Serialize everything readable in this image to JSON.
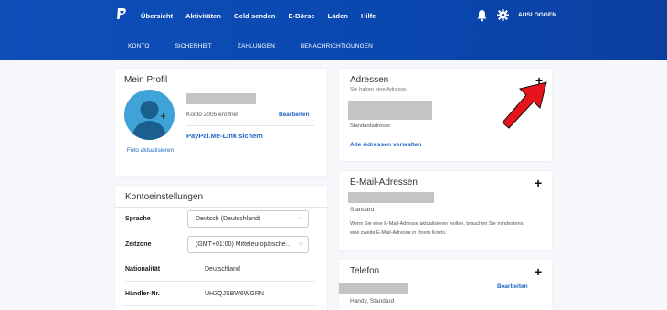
{
  "header": {
    "nav": [
      "Übersicht",
      "Aktivitäten",
      "Geld senden",
      "E-Börse",
      "Läden",
      "Hilfe"
    ],
    "logout": "AUSLOGGEN"
  },
  "subnav": [
    "KONTO",
    "SICHERHEIT",
    "ZAHLUNGEN",
    "BENACHRICHTIGUNGEN"
  ],
  "profile": {
    "title": "Mein Profil",
    "account_since": "Konto 2005 eröffnet",
    "edit": "Bearbeiten",
    "photo_update": "Foto aktualisieren",
    "paypal_me": "PayPal.Me-Link sichern"
  },
  "settings": {
    "title": "Kontoeinstellungen",
    "language_label": "Sprache",
    "language_value": "Deutsch (Deutschland)",
    "timezone_label": "Zeitzone",
    "timezone_value": "(GMT+01:00) Mitteleuropäische…",
    "nationality_label": "Nationalität",
    "nationality_value": "Deutschland",
    "merchant_label": "Händler-Nr.",
    "merchant_value": "UH2QJSBW6WGRN"
  },
  "addresses": {
    "title": "Adressen",
    "subtitle": "Sie haben eine Adresse.",
    "standard": "Standardadresse",
    "manage": "Alle Adressen verwalten"
  },
  "email": {
    "title": "E-Mail-Adressen",
    "standard": "Standard",
    "info": "Wenn Sie eine E-Mail-Adresse aktualisieren wollen, brauchen Sie mindestens eine zweite E-Mail-Adresse in Ihrem Konto."
  },
  "phone": {
    "title": "Telefon",
    "edit": "Bearbeiten",
    "type": "Handy, Standard"
  },
  "colors": {
    "brand": "#0e4fb8",
    "link": "#1e66c4",
    "arrow": "#e8141b"
  }
}
